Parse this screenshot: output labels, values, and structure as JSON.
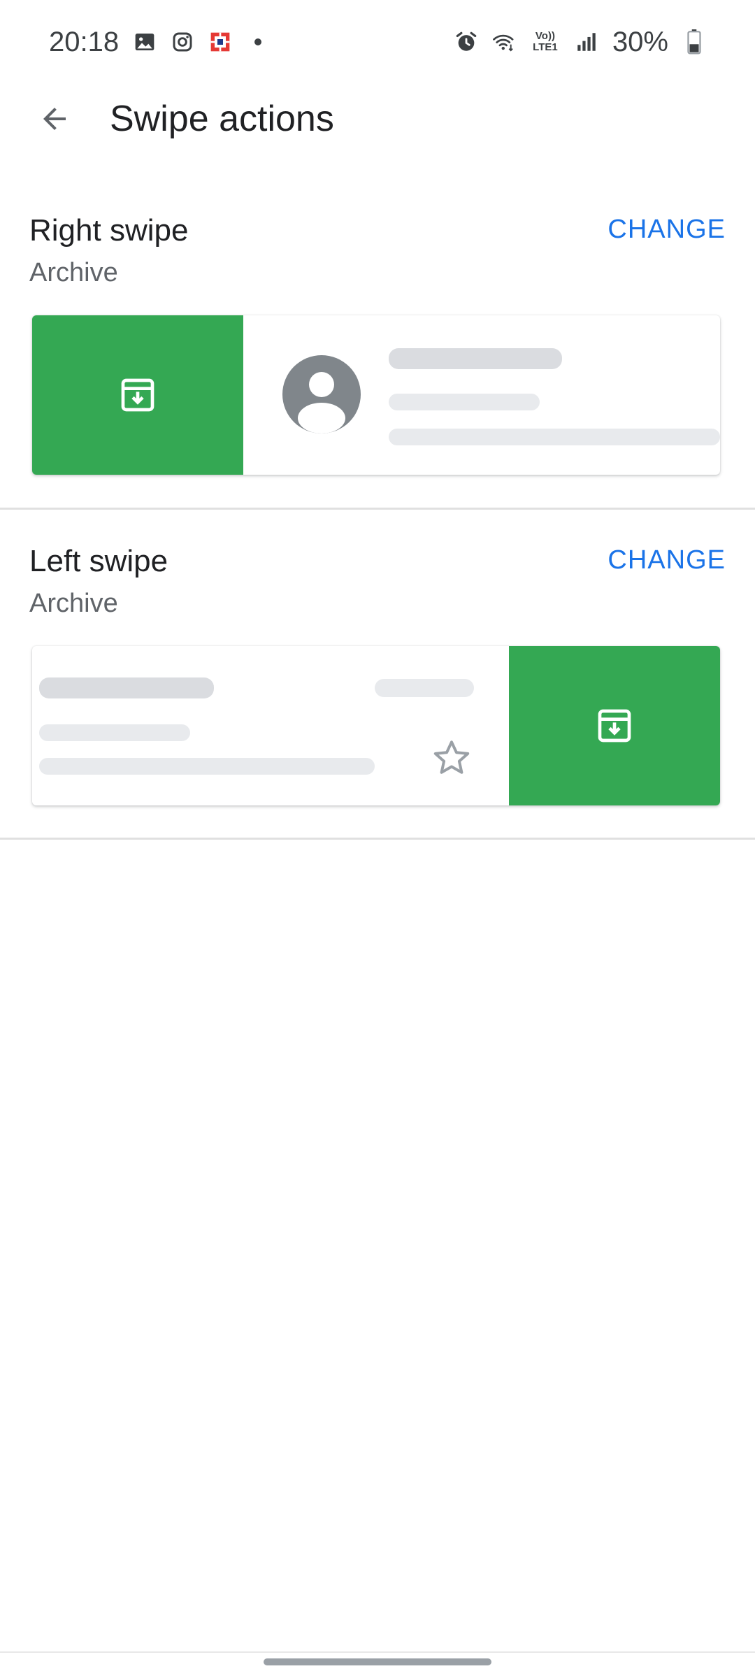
{
  "status_bar": {
    "time": "20:18",
    "battery": "30%",
    "network_label": "Vo)) LTE1",
    "left_icons": [
      "gallery-icon",
      "instagram-icon",
      "bank-app-icon",
      "notification-dot-icon"
    ],
    "right_icons": [
      "alarm-icon",
      "wifi-icon",
      "volte-icon",
      "signal-icon",
      "battery-icon"
    ]
  },
  "app_bar": {
    "title": "Swipe actions",
    "back_icon": "arrow-back-icon"
  },
  "right_swipe": {
    "title": "Right swipe",
    "value": "Archive",
    "change_label": "CHANGE",
    "action_icon": "archive-icon",
    "action_color": "#34a853"
  },
  "left_swipe": {
    "title": "Left swipe",
    "value": "Archive",
    "change_label": "CHANGE",
    "action_icon": "archive-icon",
    "action_color": "#34a853",
    "star_icon": "star-outline-icon"
  },
  "colors": {
    "accent": "#1a73e8",
    "archive_green": "#34a853",
    "placeholder": "#dadce0",
    "avatar": "#80868b"
  }
}
